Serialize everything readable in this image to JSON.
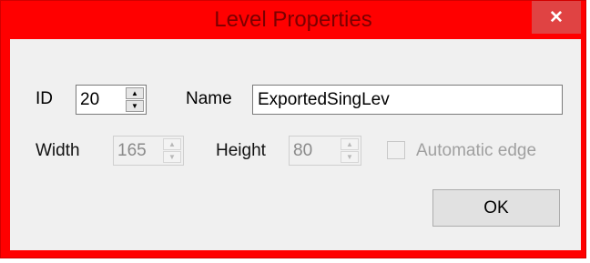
{
  "window": {
    "title": "Level Properties",
    "close_glyph": "✕",
    "frame_color": "#ff0000",
    "title_color": "#7a0000",
    "close_color": "#e04343"
  },
  "fields": {
    "id_label": "ID",
    "id_value": "20",
    "name_label": "Name",
    "name_value": "ExportedSingLev",
    "width_label": "Width",
    "width_value": "165",
    "height_label": "Height",
    "height_value": "80",
    "auto_edge_label": "Automatic edge",
    "auto_edge_checked": false
  },
  "buttons": {
    "ok_label": "OK"
  },
  "icons": {
    "up": "▲",
    "down": "▼"
  }
}
